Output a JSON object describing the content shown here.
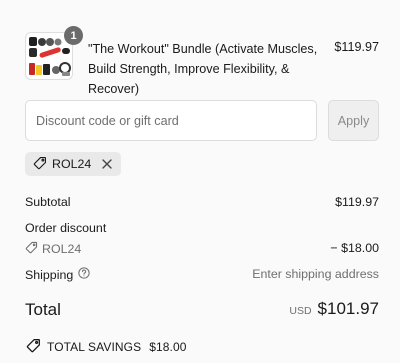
{
  "product": {
    "quantity": "1",
    "name": "\"The Workout\" Bundle (Activate Muscles, Build Strength, Improve Flexibility, & Recover)",
    "price": "$119.97"
  },
  "discount": {
    "placeholder": "Discount code or gift card",
    "value": "",
    "apply_label": "Apply"
  },
  "applied_code": {
    "code": "ROL24"
  },
  "summary": {
    "subtotal_label": "Subtotal",
    "subtotal_value": "$119.97",
    "order_discount_label": "Order discount",
    "order_discount_code": "ROL24",
    "order_discount_value": "− $18.00",
    "shipping_label": "Shipping",
    "shipping_value": "Enter shipping address",
    "total_label": "Total",
    "currency": "USD",
    "total_value": "$101.97",
    "savings_label": "TOTAL SAVINGS",
    "savings_value": "$18.00"
  },
  "icons": {
    "tag": "tag-icon",
    "remove": "close-icon",
    "help": "help-circle-icon"
  }
}
